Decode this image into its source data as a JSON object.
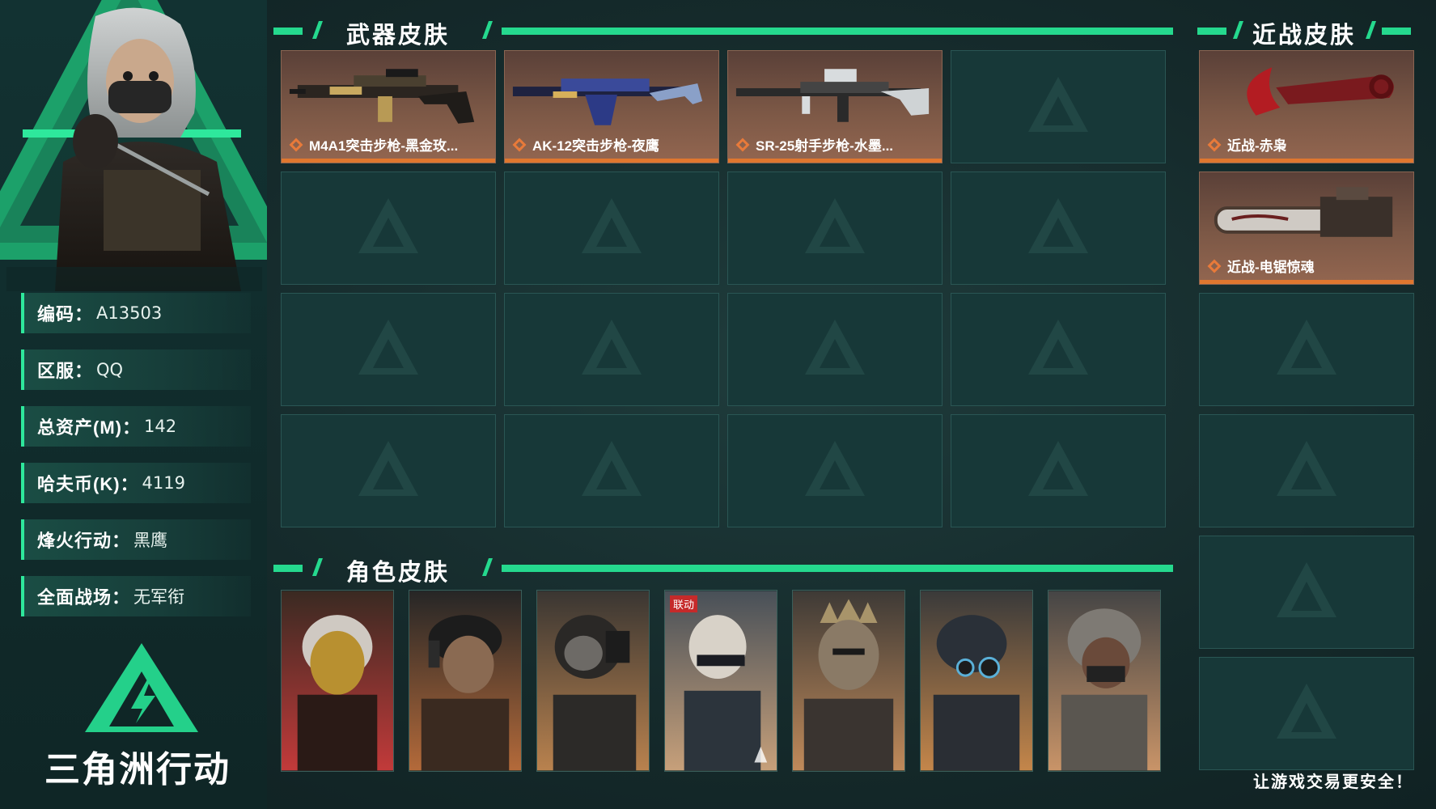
{
  "colors": {
    "accent": "#25d98e",
    "item_bottom": "#e0772f",
    "panel": "#173838"
  },
  "profile": {
    "fields": [
      {
        "label": "编码：",
        "value": "A13503"
      },
      {
        "label": "区服：",
        "value": "QQ"
      },
      {
        "label": "总资产(M)：",
        "value": "142"
      },
      {
        "label": "哈夫币(K)：",
        "value": "4119"
      },
      {
        "label": "烽火行动：",
        "value": "黑鹰"
      },
      {
        "label": "全面战场：",
        "value": "无军衔"
      }
    ]
  },
  "brand": {
    "name": "三角洲行动"
  },
  "weapon_skins": {
    "title": "武器皮肤",
    "items": [
      {
        "label": "M4A1突击步枪-黑金玫...",
        "icon": "rifle-gold-icon"
      },
      {
        "label": "AK-12突击步枪-夜鹰",
        "icon": "rifle-blue-icon"
      },
      {
        "label": "SR-25射手步枪-水墨...",
        "icon": "rifle-ink-icon"
      }
    ]
  },
  "melee_skins": {
    "title": "近战皮肤",
    "items": [
      {
        "label": "近战-赤枭",
        "icon": "karambit-icon"
      },
      {
        "label": "近战-电锯惊魂",
        "icon": "chainsaw-icon"
      }
    ]
  },
  "character_skins": {
    "title": "角色皮肤",
    "linked_badge": "联动",
    "cards": [
      {
        "icon": "operator-gold-mask-icon"
      },
      {
        "icon": "operator-headset-icon"
      },
      {
        "icon": "operator-helmet-icon"
      },
      {
        "icon": "operator-linked-icon"
      },
      {
        "icon": "operator-crown-mask-icon"
      },
      {
        "icon": "operator-nightvision-icon"
      },
      {
        "icon": "operator-gasmask-icon"
      }
    ]
  },
  "footer": {
    "slogan": "让游戏交易更安全！"
  }
}
